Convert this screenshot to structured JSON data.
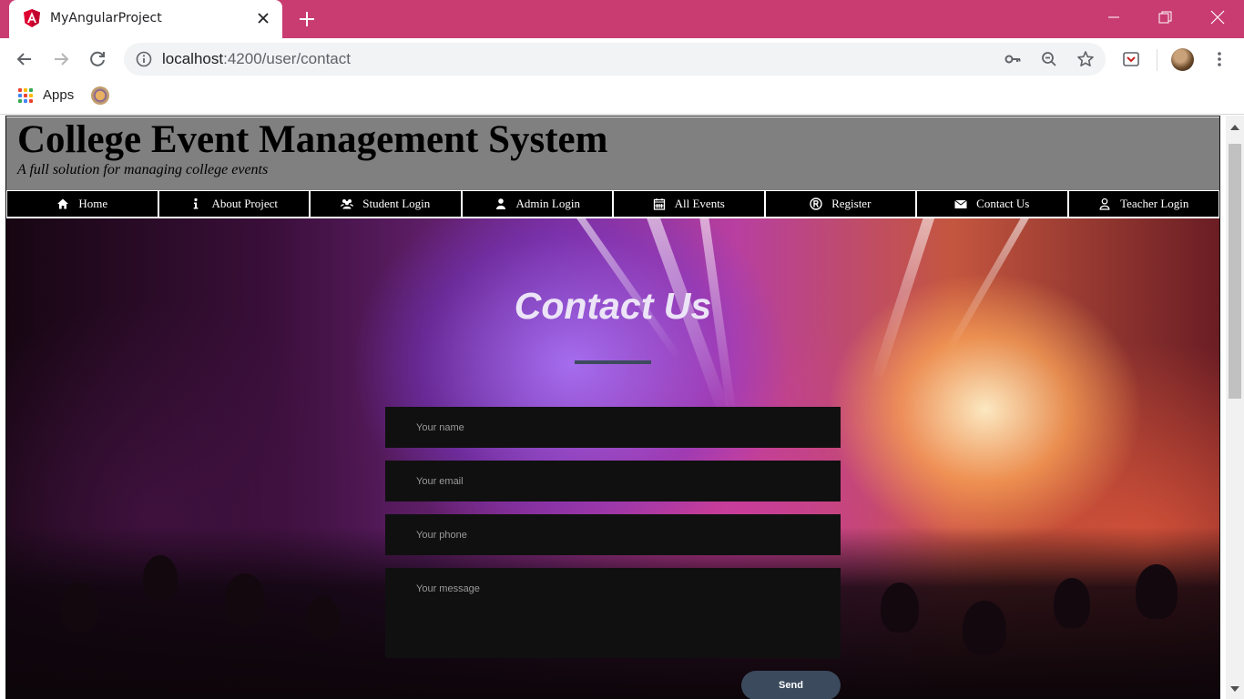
{
  "browser": {
    "tab_title": "MyAngularProject",
    "url_host": "localhost",
    "url_path": ":4200/user/contact",
    "bookmarks": {
      "apps_label": "Apps"
    }
  },
  "site": {
    "title": "College Event Management System",
    "tagline": "A full solution for managing college events",
    "nav": [
      {
        "label": "Home",
        "icon": "home-icon"
      },
      {
        "label": "About Project",
        "icon": "info-icon"
      },
      {
        "label": "Student Login",
        "icon": "users-icon"
      },
      {
        "label": "Admin Login",
        "icon": "user-icon"
      },
      {
        "label": "All Events",
        "icon": "calendar-icon"
      },
      {
        "label": "Register",
        "icon": "registered-icon"
      },
      {
        "label": "Contact Us",
        "icon": "envelope-icon"
      },
      {
        "label": "Teacher Login",
        "icon": "user-outline-icon"
      }
    ]
  },
  "contact": {
    "heading": "Contact Us",
    "name_placeholder": "Your name",
    "email_placeholder": "Your email",
    "phone_placeholder": "Your phone",
    "message_placeholder": "Your message",
    "send_label": "Send"
  },
  "colors": {
    "tab_strip": "#c93c72",
    "header_bg": "#808080",
    "nav_bg": "#000000",
    "field_bg": "#101010",
    "send_bg": "#3b4a5d"
  }
}
